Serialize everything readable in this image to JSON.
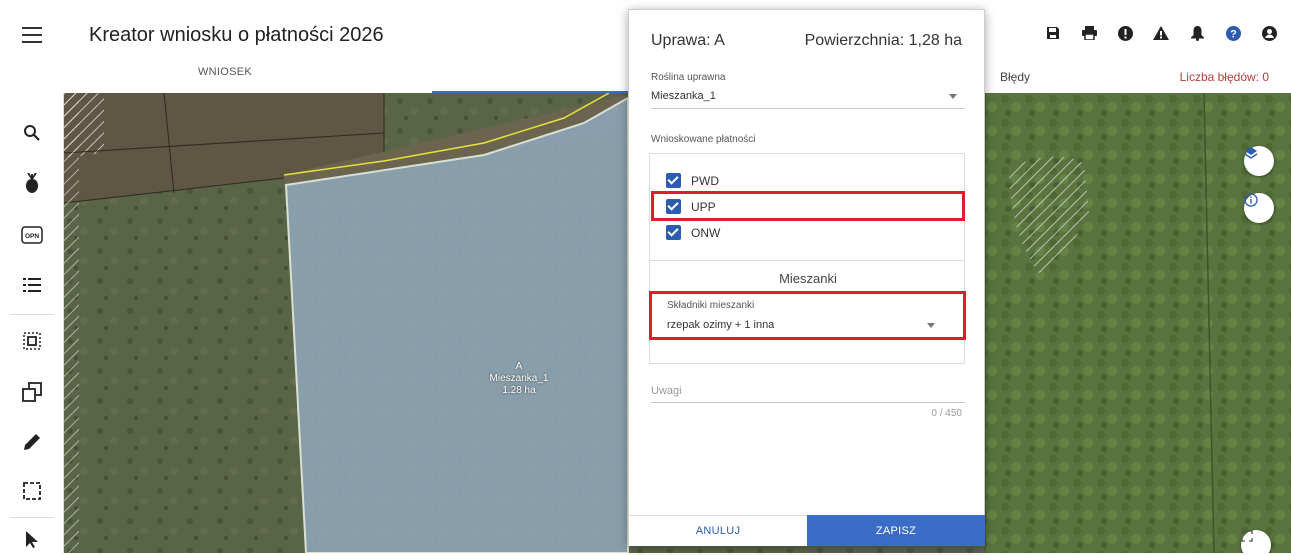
{
  "header": {
    "title": "Kreator wniosku o płatności 2026",
    "tab_wniosek": "WNIOSEK",
    "errors_label": "Błędy",
    "errors_count": "Liczba błędów: 0",
    "icons": [
      "save-icon",
      "print-icon",
      "alert-circle-icon",
      "warning-icon",
      "bell-icon",
      "help-icon",
      "account-icon"
    ]
  },
  "left_tools": [
    "search-icon",
    "crop-icon",
    "opn-icon",
    "list-icon",
    "select-area-icon",
    "copy-shape-icon",
    "pencil-icon",
    "select-rect-icon",
    "cursor-icon"
  ],
  "left_tools_opn_text": "OPN",
  "map": {
    "parcel_label_line1": "A",
    "parcel_label_line2": "Mieszanka_1",
    "parcel_label_line3": "1.28 ha"
  },
  "dialog": {
    "title": "Uprawa: A",
    "area": "Powierzchnia: 1,28 ha",
    "crop_label": "Roślina uprawna",
    "crop_value": "Mieszanka_1",
    "payments_label": "Wnioskowane płatności",
    "payments": [
      {
        "label": "PWD",
        "checked": true
      },
      {
        "label": "UPP",
        "checked": true
      },
      {
        "label": "ONW",
        "checked": true
      }
    ],
    "mix_title": "Mieszanki",
    "mix_components_label": "Składniki mieszanki",
    "mix_components_value": "rzepak ozimy + 1 inna",
    "notes_label": "Uwagi",
    "notes_count": "0 / 450",
    "cancel_label": "ANULUJ",
    "save_label": "ZAPISZ"
  },
  "colors": {
    "accent": "#3b6cc7",
    "highlight": "#e01d2a",
    "error_count": "#b3403a"
  }
}
